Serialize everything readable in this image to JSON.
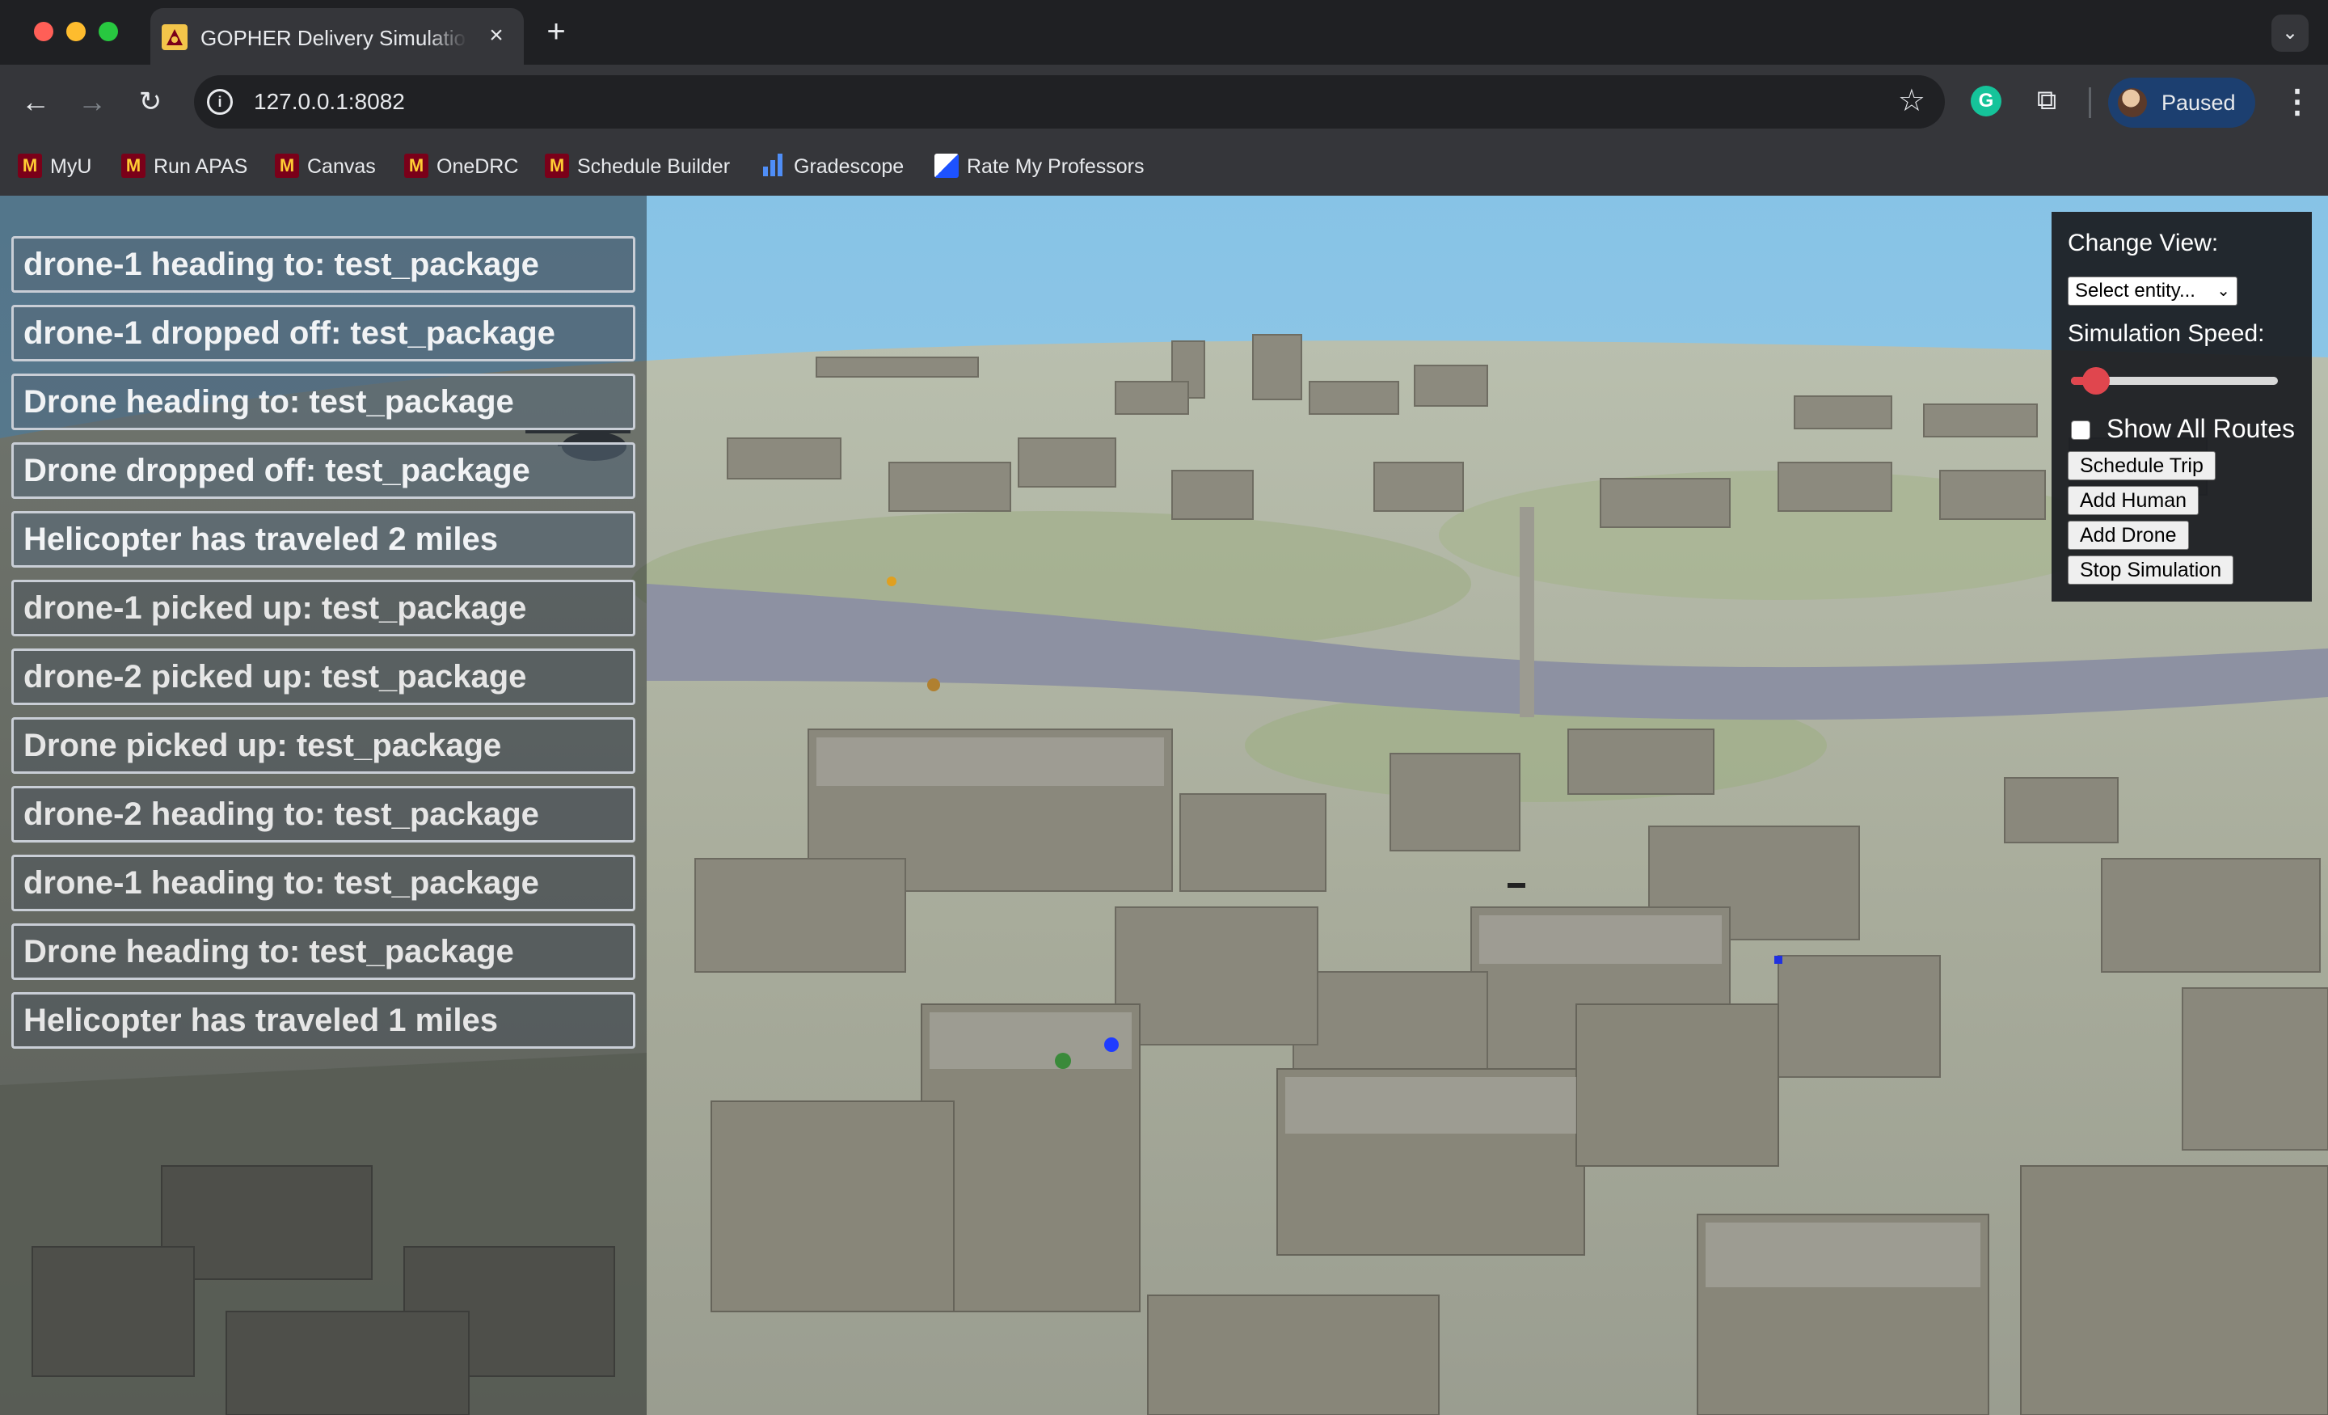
{
  "browser": {
    "tab_title": "GOPHER Delivery Simulation",
    "url": "127.0.0.1:8082",
    "profile_label": "Paused",
    "bookmarks": [
      {
        "label": "MyU",
        "icon": "umn-block-m-icon"
      },
      {
        "label": "Run APAS",
        "icon": "umn-block-m-icon"
      },
      {
        "label": "Canvas",
        "icon": "umn-block-m-icon"
      },
      {
        "label": "OneDRC",
        "icon": "umn-block-m-icon"
      },
      {
        "label": "Schedule Builder",
        "icon": "umn-block-m-icon"
      },
      {
        "label": "Gradescope",
        "icon": "gradescope-bars-icon"
      },
      {
        "label": "Rate My Professors",
        "icon": "rmp-icon"
      }
    ]
  },
  "notifications": [
    "drone-1 heading to: test_package",
    "drone-1 dropped off: test_package",
    "Drone heading to: test_package",
    "Drone dropped off: test_package",
    "Helicopter has traveled 2 miles",
    "drone-1 picked up: test_package",
    "drone-2 picked up: test_package",
    "Drone picked up: test_package",
    "drone-2 heading to: test_package",
    "drone-1 heading to: test_package",
    "Drone heading to: test_package",
    "Helicopter has traveled 1 miles"
  ],
  "controls": {
    "change_view_label": "Change View:",
    "entity_select_value": "Select entity...",
    "speed_label": "Simulation Speed:",
    "speed_value_fraction": 0.12,
    "show_routes_label": "Show All Routes",
    "show_routes_checked": false,
    "buttons": {
      "schedule": "Schedule Trip",
      "add_human": "Add Human",
      "add_drone": "Add Drone",
      "stop": "Stop Simulation"
    }
  },
  "colors": {
    "sky": "#8fc8e8",
    "building": "#8c8a7e",
    "river": "#8a8fa0",
    "slider_accent": "#e0464e"
  }
}
